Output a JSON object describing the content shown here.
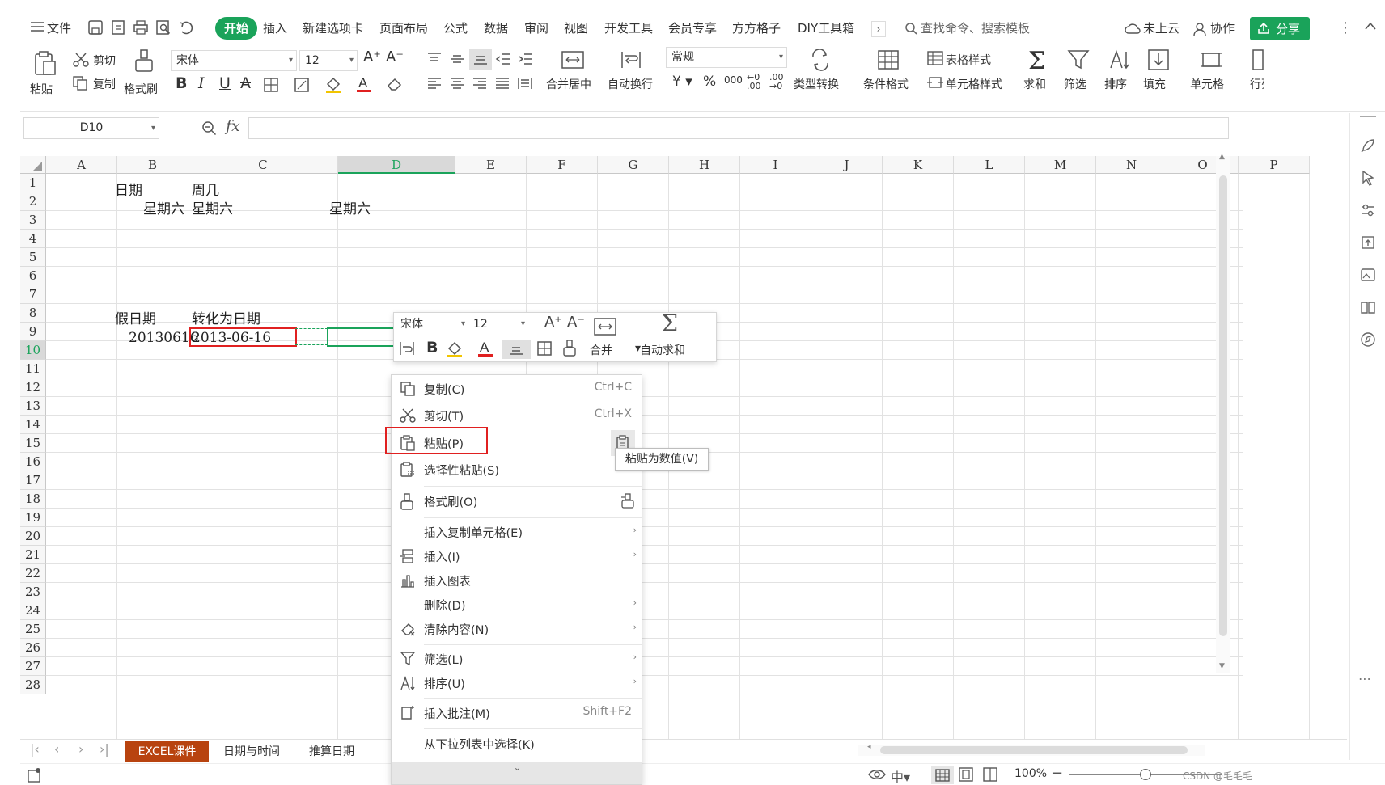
{
  "menu": {
    "hamburger_label": "文件",
    "tabs": [
      "开始",
      "插入",
      "新建选项卡",
      "页面布局",
      "公式",
      "数据",
      "审阅",
      "视图",
      "开发工具",
      "会员专享",
      "方方格子",
      "DIY工具箱"
    ],
    "search_placeholder": "查找命令、搜索模板",
    "cloud_status": "未上云",
    "collab": "协作",
    "share": "分享"
  },
  "ribbon": {
    "paste": "粘贴",
    "cut": "剪切",
    "copy": "复制",
    "format_painter": "格式刷",
    "font_name": "宋体",
    "font_size": "12",
    "merge_center": "合并居中",
    "wrap_text": "自动换行",
    "number_format": "常规",
    "type_convert": "类型转换",
    "conditional_format": "条件格式",
    "table_style": "表格样式",
    "cell_style": "单元格样式",
    "sum": "求和",
    "filter": "筛选",
    "sort": "排序",
    "fill": "填充",
    "cell": "单元格",
    "rowcol": "行列"
  },
  "formula_bar": {
    "name_box": "D10",
    "fx": "fx",
    "content": ""
  },
  "grid": {
    "columns": [
      "A",
      "B",
      "C",
      "D",
      "E",
      "F",
      "G",
      "H",
      "I",
      "J",
      "K",
      "L",
      "M",
      "N",
      "O",
      "P"
    ],
    "rows": [
      "1",
      "2",
      "3",
      "4",
      "5",
      "6",
      "7",
      "8",
      "9",
      "10",
      "11",
      "12",
      "13",
      "14",
      "15",
      "16",
      "17",
      "18",
      "19",
      "20",
      "21",
      "22",
      "23",
      "24",
      "25",
      "26",
      "27",
      "28"
    ],
    "cells": {
      "B2": "日期",
      "C2": "周几",
      "B3": "星期六",
      "C3": "星期六",
      "D3": "星期六",
      "B9": "假日期",
      "C9": "转化为日期",
      "B10": "20130616",
      "C10": "2013-06-16"
    },
    "selected_cell": "D10"
  },
  "mini_toolbar": {
    "font_name": "宋体",
    "font_size": "12",
    "merge": "合并",
    "autosum": "自动求和"
  },
  "context_menu": {
    "items": [
      {
        "label": "复制(C)",
        "shortcut": "Ctrl+C"
      },
      {
        "label": "剪切(T)",
        "shortcut": "Ctrl+X"
      },
      {
        "label": "粘贴(P)",
        "shortcut": ""
      },
      {
        "label": "选择性粘贴(S)",
        "shortcut": ""
      },
      {
        "label": "格式刷(O)",
        "shortcut": ""
      },
      {
        "label": "插入复制单元格(E)",
        "shortcut": ""
      },
      {
        "label": "插入(I)",
        "shortcut": ""
      },
      {
        "label": "插入图表",
        "shortcut": ""
      },
      {
        "label": "删除(D)",
        "shortcut": ""
      },
      {
        "label": "清除内容(N)",
        "shortcut": ""
      },
      {
        "label": "筛选(L)",
        "shortcut": ""
      },
      {
        "label": "排序(U)",
        "shortcut": ""
      },
      {
        "label": "插入批注(M)",
        "shortcut": "Shift+F2"
      },
      {
        "label": "从下拉列表中选择(K)",
        "shortcut": ""
      }
    ],
    "tooltip": "粘贴为数值(V)"
  },
  "sheets": {
    "tabs": [
      "EXCEL课件",
      "日期与时间",
      "推算日期"
    ],
    "active": "EXCEL课件",
    "active_color": "#b8430f"
  },
  "status": {
    "zoom": "100%",
    "watermark": "CSDN @毛毛毛"
  },
  "colors": {
    "accent": "#1aa35a",
    "highlight_box": "#e02020"
  }
}
